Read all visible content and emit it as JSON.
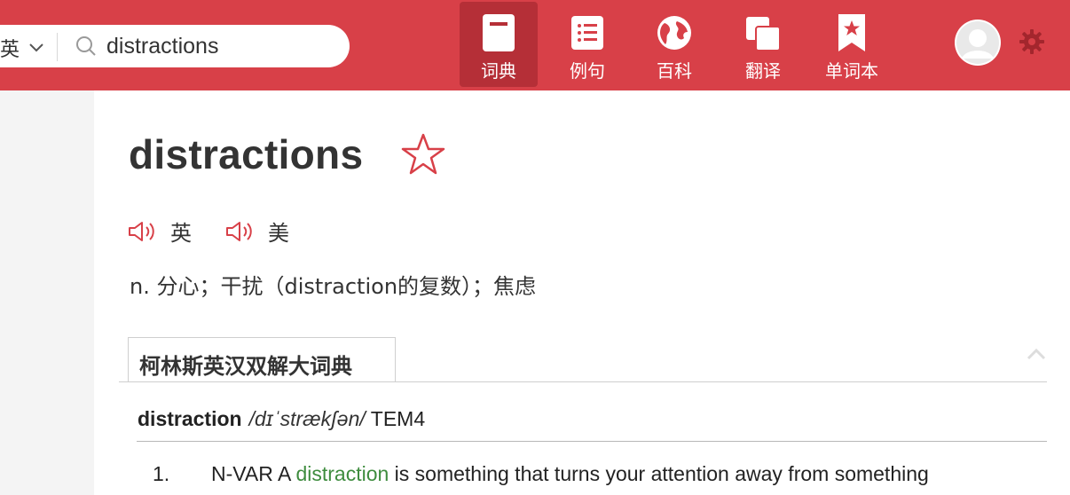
{
  "header": {
    "language": "英",
    "search": {
      "value": "distractions",
      "placeholder": ""
    },
    "nav": [
      {
        "label": "词典",
        "icon": "dictionary-book-icon",
        "active": true
      },
      {
        "label": "例句",
        "icon": "list-icon",
        "active": false
      },
      {
        "label": "百科",
        "icon": "globe-icon",
        "active": false
      },
      {
        "label": "翻译",
        "icon": "translate-icon",
        "active": false
      },
      {
        "label": "单词本",
        "icon": "bookmark-star-icon",
        "active": false
      }
    ],
    "accent_color": "#d84048"
  },
  "entry": {
    "headword": "distractions",
    "pronunciations": [
      {
        "label": "英"
      },
      {
        "label": "美"
      }
    ],
    "definition": "n. 分心；干扰（distraction的复数）；焦虑",
    "tab_label": "柯林斯英汉双解大词典",
    "collins": {
      "word": "distraction",
      "phonetic": "/dɪˈstrækʃən/",
      "level": "TEM4",
      "sense_number": "1.",
      "sense_pos": "N-VAR",
      "sense_pre": " A ",
      "sense_highlight": "distraction",
      "sense_post": " is something that turns your attention away from something"
    }
  }
}
